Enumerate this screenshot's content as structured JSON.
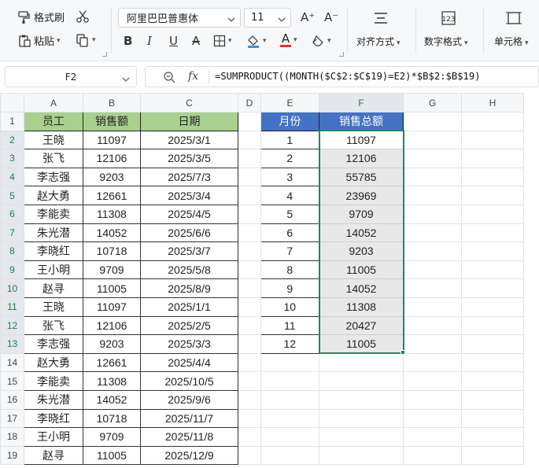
{
  "ribbon": {
    "format_painter": "格式刷",
    "paste": "粘贴",
    "font_name": "阿里巴巴普惠体",
    "font_size": "11",
    "grow_font": "A⁺",
    "shrink_font": "A⁻",
    "bold": "B",
    "italic": "I",
    "underline": "U",
    "strikethrough": "A",
    "font_color_letter": "A",
    "align_label": "对齐方式",
    "number_format_label": "数字格式",
    "cell_label": "单元格"
  },
  "formula_bar": {
    "name_box": "F2",
    "fx": "fx",
    "formula": "=SUMPRODUCT((MONTH($C$2:$C$19)=E2)*$B$2:$B$19)"
  },
  "sheet": {
    "columns": [
      "A",
      "B",
      "C",
      "D",
      "E",
      "F",
      "G",
      "H"
    ],
    "selected_column": "F",
    "headers": {
      "A": "员工",
      "B": "销售额",
      "C": "日期",
      "E": "月份",
      "F": "销售总额"
    },
    "rows": [
      {
        "n": "1"
      },
      {
        "n": "2",
        "a": "王晓",
        "b": "11097",
        "c": "2025/3/1",
        "e": "1",
        "f": "11097"
      },
      {
        "n": "3",
        "a": "张飞",
        "b": "12106",
        "c": "2025/3/5",
        "e": "2",
        "f": "12106"
      },
      {
        "n": "4",
        "a": "李志强",
        "b": "9203",
        "c": "2025/7/3",
        "e": "3",
        "f": "55785"
      },
      {
        "n": "5",
        "a": "赵大勇",
        "b": "12661",
        "c": "2025/3/4",
        "e": "4",
        "f": "23969"
      },
      {
        "n": "6",
        "a": "李能卖",
        "b": "11308",
        "c": "2025/4/5",
        "e": "5",
        "f": "9709"
      },
      {
        "n": "7",
        "a": "朱光潜",
        "b": "14052",
        "c": "2025/6/6",
        "e": "6",
        "f": "14052"
      },
      {
        "n": "8",
        "a": "李晓红",
        "b": "10718",
        "c": "2025/3/7",
        "e": "7",
        "f": "9203"
      },
      {
        "n": "9",
        "a": "王小明",
        "b": "9709",
        "c": "2025/5/8",
        "e": "8",
        "f": "11005"
      },
      {
        "n": "10",
        "a": "赵寻",
        "b": "11005",
        "c": "2025/8/9",
        "e": "9",
        "f": "14052"
      },
      {
        "n": "11",
        "a": "王晓",
        "b": "11097",
        "c": "2025/1/1",
        "e": "10",
        "f": "11308"
      },
      {
        "n": "12",
        "a": "张飞",
        "b": "12106",
        "c": "2025/2/5",
        "e": "11",
        "f": "20427"
      },
      {
        "n": "13",
        "a": "李志强",
        "b": "9203",
        "c": "2025/3/3",
        "e": "12",
        "f": "11005"
      },
      {
        "n": "14",
        "a": "赵大勇",
        "b": "12661",
        "c": "2025/4/4"
      },
      {
        "n": "15",
        "a": "李能卖",
        "b": "11308",
        "c": "2025/10/5"
      },
      {
        "n": "16",
        "a": "朱光潜",
        "b": "14052",
        "c": "2025/9/6"
      },
      {
        "n": "17",
        "a": "李晓红",
        "b": "10718",
        "c": "2025/11/7"
      },
      {
        "n": "18",
        "a": "王小明",
        "b": "9709",
        "c": "2025/11/8"
      },
      {
        "n": "19",
        "a": "赵寻",
        "b": "11005",
        "c": "2025/12/9"
      }
    ]
  },
  "colors": {
    "header_green": "#a9d08e",
    "header_blue": "#4472c4",
    "selection_green": "#1e8a5a"
  }
}
